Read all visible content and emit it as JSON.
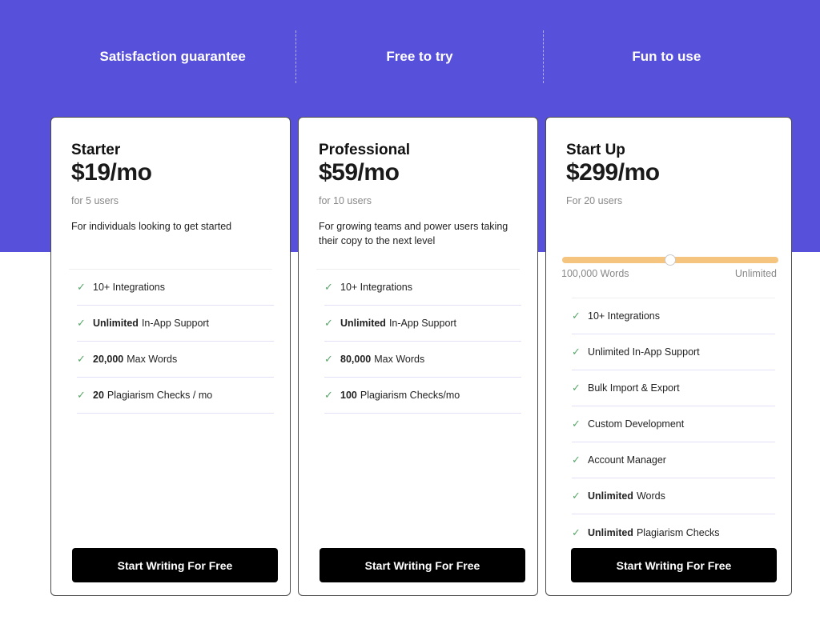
{
  "colors": {
    "brand": "#5750DA",
    "check": "#5BA66B",
    "slider": "#F5C47E",
    "cta": "#000000"
  },
  "guarantees": [
    "Satisfaction guarantee",
    "Free to try",
    "Fun to use"
  ],
  "plans": [
    {
      "name": "Starter",
      "price": "$19/mo",
      "users": "for 5 users",
      "description": "For individuals looking to get started",
      "features": [
        {
          "bold": "",
          "text": "10+ Integrations"
        },
        {
          "bold": "Unlimited",
          "text": "In-App Support"
        },
        {
          "bold": "20,000",
          "text": "Max Words"
        },
        {
          "bold": "20",
          "text": "Plagiarism Checks / mo"
        }
      ],
      "cta": "Start Writing For Free"
    },
    {
      "name": "Professional",
      "price": "$59/mo",
      "users": "for 10 users",
      "description": "For growing teams and power users taking their copy to the next level",
      "features": [
        {
          "bold": "",
          "text": "10+ Integrations"
        },
        {
          "bold": "Unlimited",
          "text": "In-App Support"
        },
        {
          "bold": "80,000",
          "text": "Max Words"
        },
        {
          "bold": "100",
          "text": "Plagiarism Checks/mo"
        }
      ],
      "cta": "Start Writing For Free"
    },
    {
      "name": "Start Up",
      "price": "$299/mo",
      "users": "For 20 users",
      "slider": {
        "min_label": "100,000 Words",
        "max_label": "Unlimited",
        "value_fraction": 0.5
      },
      "features": [
        {
          "bold": "",
          "text": "10+ Integrations"
        },
        {
          "bold": "",
          "text": "Unlimited In-App Support"
        },
        {
          "bold": "",
          "text": "Bulk Import & Export"
        },
        {
          "bold": "",
          "text": "Custom Development"
        },
        {
          "bold": "",
          "text": "Account Manager"
        },
        {
          "bold": "Unlimited",
          "text": "Words"
        },
        {
          "bold": "Unlimited",
          "text": "Plagiarism Checks"
        }
      ],
      "cta": "Start Writing For Free"
    }
  ]
}
